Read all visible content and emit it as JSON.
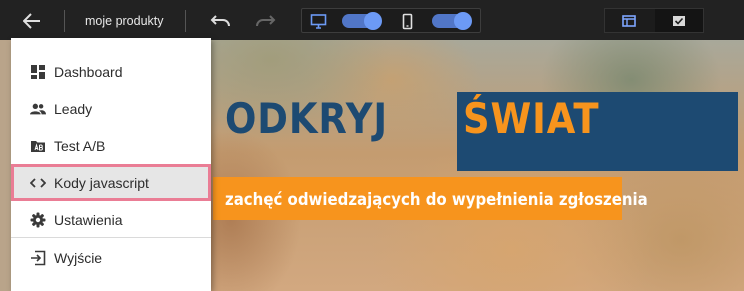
{
  "toolbar": {
    "project_name": "moje produkty"
  },
  "hero": {
    "heading_part1": "ODKRYJ",
    "heading_part2": "ŚWIAT",
    "subheading": "zachęć odwiedzających do wypełnienia zgłoszenia"
  },
  "menu": {
    "items": [
      {
        "label": "Dashboard",
        "icon": "dashboard-icon"
      },
      {
        "label": "Leady",
        "icon": "people-icon"
      },
      {
        "label": "Test A/B",
        "icon": "ab-test-icon"
      },
      {
        "label": "Kody javascript",
        "icon": "code-icon",
        "highlighted": true
      },
      {
        "label": "Ustawienia",
        "icon": "gear-icon"
      },
      {
        "label": "Wyjście",
        "icon": "exit-icon"
      }
    ]
  },
  "colors": {
    "toolbar_bg": "#222222",
    "accent_blue": "#1d4a72",
    "accent_orange": "#f7941d",
    "toggle_on": "#6c9af5",
    "highlight_border": "#ea7d95"
  }
}
